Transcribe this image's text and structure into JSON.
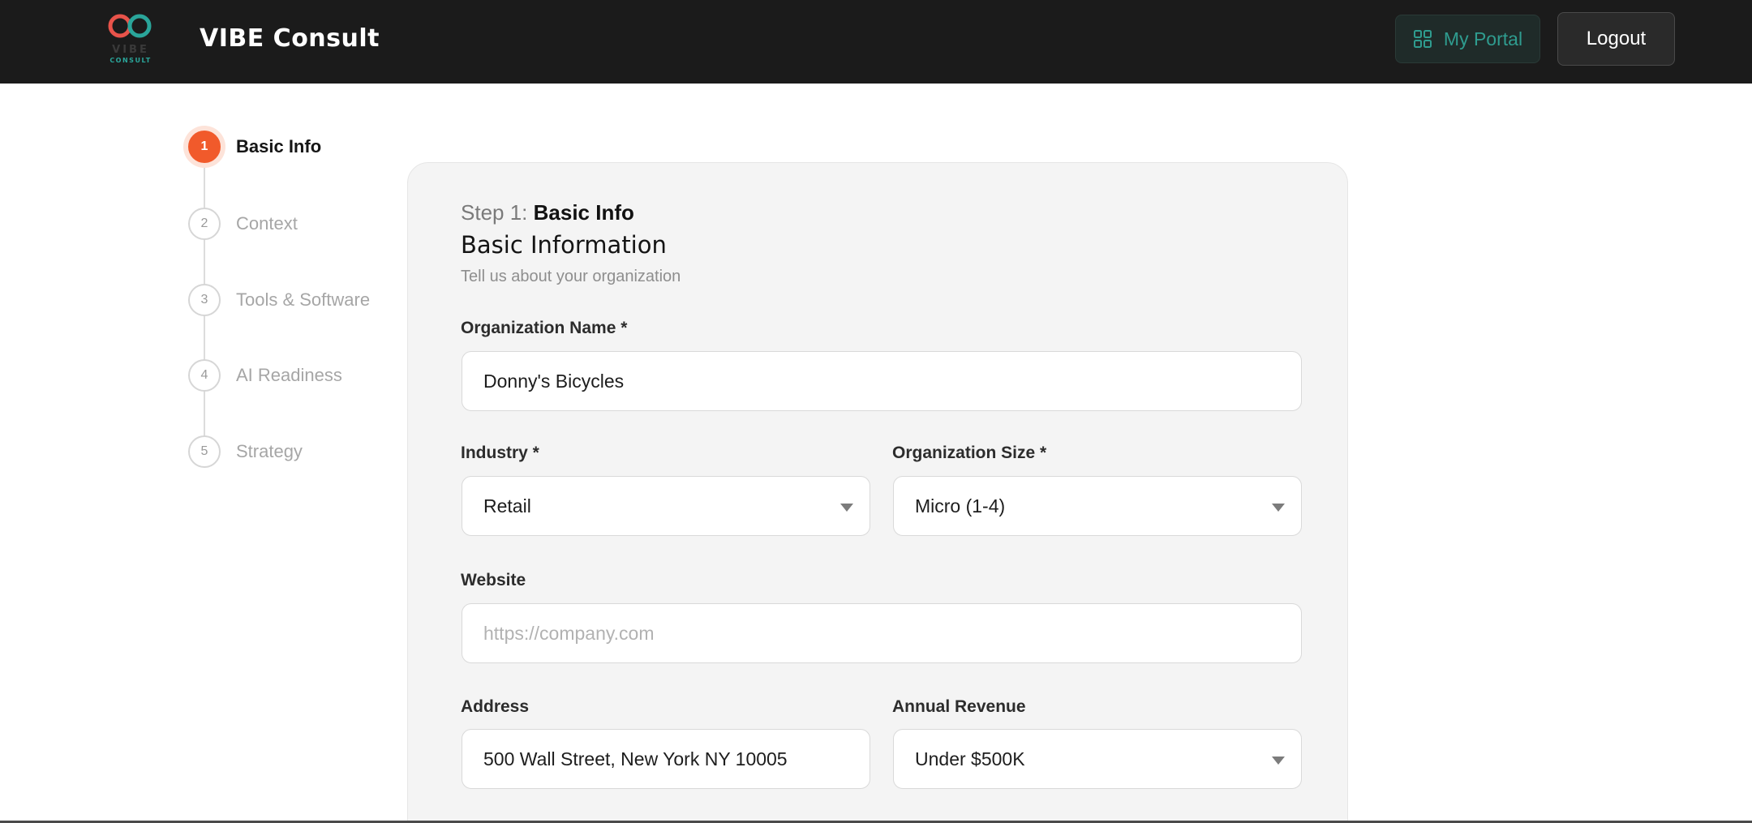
{
  "header": {
    "logo_word": "VIBE",
    "logo_sub": "CONSULT",
    "brand": "VIBE Consult",
    "portal_label": "My Portal",
    "logout_label": "Logout",
    "colors": {
      "bar": "#1b1b1b",
      "accent": "#2f9c8f"
    }
  },
  "stepper": {
    "active_color": "#f15a2b",
    "steps": [
      {
        "num": "1",
        "label": "Basic Info",
        "active": true
      },
      {
        "num": "2",
        "label": "Context",
        "active": false
      },
      {
        "num": "3",
        "label": "Tools & Software",
        "active": false
      },
      {
        "num": "4",
        "label": "AI Readiness",
        "active": false
      },
      {
        "num": "5",
        "label": "Strategy",
        "active": false
      }
    ]
  },
  "form": {
    "step_prefix": "Step 1: ",
    "step_name": "Basic Info",
    "title": "Basic Information",
    "subtitle": "Tell us about your organization",
    "org_name": {
      "label": "Organization Name *",
      "value": "Donny's Bicycles"
    },
    "industry": {
      "label": "Industry *",
      "value": "Retail"
    },
    "org_size": {
      "label": "Organization Size *",
      "value": "Micro (1-4)"
    },
    "website": {
      "label": "Website",
      "value": "",
      "placeholder": "https://company.com"
    },
    "address": {
      "label": "Address",
      "value": "500 Wall Street, New York NY 10005"
    },
    "revenue": {
      "label": "Annual Revenue",
      "value": "Under $500K"
    }
  }
}
